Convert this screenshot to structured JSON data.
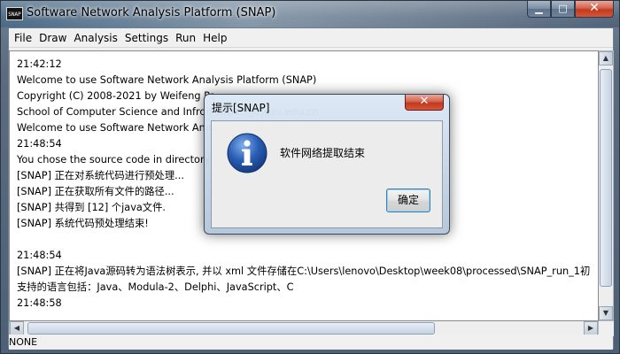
{
  "window": {
    "title": "Software Network Analysis Platform (SNAP)",
    "logo_text": "SNAP"
  },
  "menubar": {
    "items": [
      "File",
      "Draw",
      "Analysis",
      "Settings",
      "Run",
      "Help"
    ]
  },
  "log": {
    "lines": [
      "21:42:12",
      "Welcome to use Software Network Analysis Platform (SNAP)",
      "Copyright (C) 2008-2021 by Weifeng Pa",
      "School of Computer Science and Infron                                              wfpan@zjgsu.edu.cn",
      "Welcome to use Software Network Anal",
      "21:48:54",
      "You chose the source code in directory",
      "[SNAP] 正在对系统代码进行预处理...",
      "[SNAP] 正在获取所有文件的路径...",
      "[SNAP] 共得到 [12] 个java文件.",
      "[SNAP] 系统代码预处理结束!",
      "",
      "21:48:54",
      "[SNAP] 正在将Java源码转为语法树表示, 并以 xml 文件存储在C:\\Users\\lenovo\\Desktop\\week08\\processed\\SNAP_run_1初",
      "支持的语言包括：Java、Modula-2、Delphi、JavaScript、C",
      "21:48:58"
    ]
  },
  "statusbar": {
    "text": "NONE"
  },
  "dialog": {
    "title": "提示[SNAP]",
    "message": "软件网络提取结束",
    "ok_label": "确定",
    "icon": "info-icon"
  },
  "colors": {
    "info_icon": "#2a5fb5",
    "close_button": "#c2391f"
  }
}
